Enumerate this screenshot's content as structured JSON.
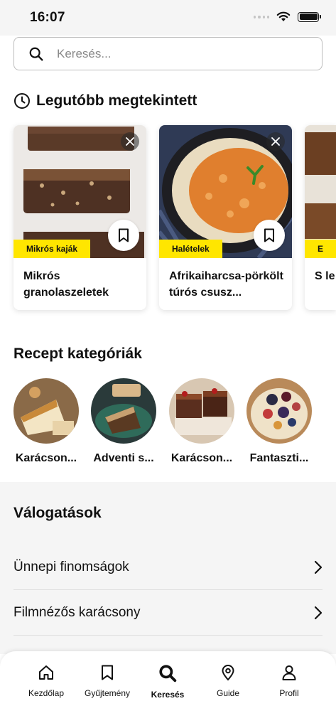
{
  "status_bar": {
    "time": "16:07"
  },
  "search": {
    "placeholder": "Keresés..."
  },
  "recent": {
    "title": "Legutóbb megtekintett",
    "cards": [
      {
        "category": "Mikrós kaják",
        "title": "Mikrós granolaszeletek"
      },
      {
        "category": "Halételek",
        "title": "Afrikaiharcsa-pörkölt túrós csusz..."
      },
      {
        "category": "E",
        "title": "S le"
      }
    ]
  },
  "categories": {
    "title": "Recept kategóriák",
    "items": [
      {
        "label": "Karácson..."
      },
      {
        "label": "Adventi s..."
      },
      {
        "label": "Karácson..."
      },
      {
        "label": "Fantaszti..."
      }
    ]
  },
  "selections": {
    "title": "Válogatások",
    "rows": [
      {
        "label": "Ünnepi finomságok"
      },
      {
        "label": "Filmnézős karácsony"
      }
    ]
  },
  "tab_bar": {
    "tabs": [
      {
        "label": "Kezdőlap",
        "icon": "home-icon"
      },
      {
        "label": "Gyűjtemény",
        "icon": "bookmark-icon"
      },
      {
        "label": "Keresés",
        "icon": "search-icon",
        "active": true
      },
      {
        "label": "Guide",
        "icon": "location-pin-icon"
      },
      {
        "label": "Profil",
        "icon": "user-icon"
      }
    ]
  },
  "colors": {
    "accent_yellow": "#ffe600",
    "text": "#111111",
    "section_bg": "#f5f5f5"
  }
}
